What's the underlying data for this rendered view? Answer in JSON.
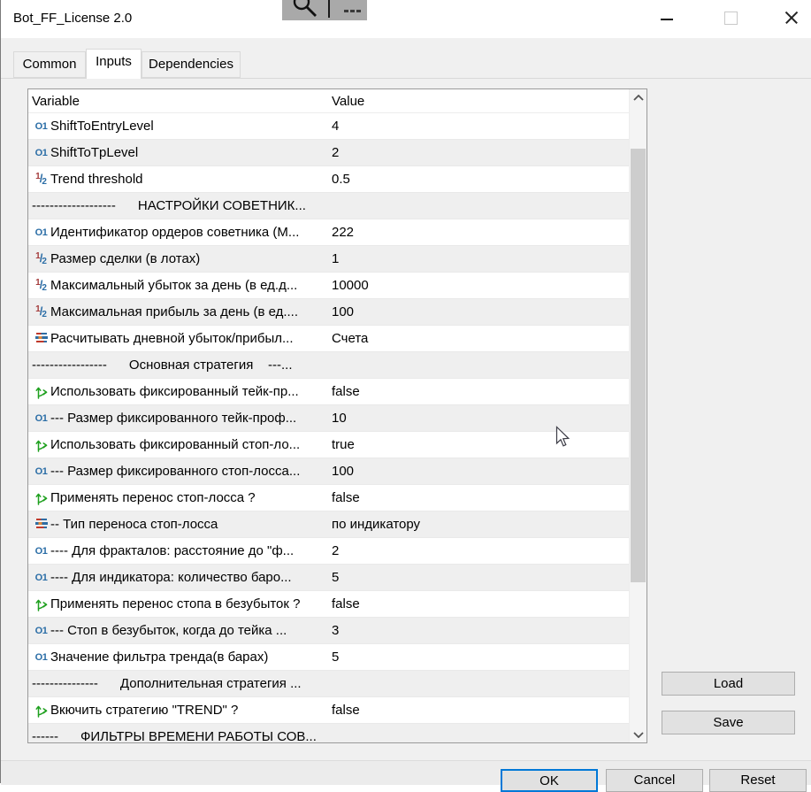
{
  "window": {
    "title": "Bot_FF_License 2.0",
    "controls": {
      "minimize": "minimize",
      "maximize": "maximize",
      "close": "close"
    }
  },
  "capture_toolbar": {
    "icons": [
      "magnifier-icon",
      "caret-divider",
      "ellipsis-icon"
    ]
  },
  "tabs": [
    {
      "label": "Common",
      "active": false
    },
    {
      "label": "Inputs",
      "active": true
    },
    {
      "label": "Dependencies",
      "active": false
    }
  ],
  "table": {
    "columns": [
      "Variable",
      "Value"
    ],
    "rows": [
      {
        "type": "int",
        "label": "ShiftToEntryLevel",
        "value": "4"
      },
      {
        "type": "int",
        "label": "ShiftToTpLevel",
        "value": "2"
      },
      {
        "type": "double",
        "label": "Trend threshold",
        "value": "0.5"
      },
      {
        "type": "sep",
        "label": "-------------------      НАСТРОЙКИ СОВЕТНИК...",
        "value": ""
      },
      {
        "type": "int",
        "label": "Идентификатор ордеров советника (М...",
        "value": "222"
      },
      {
        "type": "double",
        "label": "Размер сделки (в лотах)",
        "value": "1"
      },
      {
        "type": "double",
        "label": "Максимальный убыток за день (в ед.д...",
        "value": "10000"
      },
      {
        "type": "double",
        "label": "Максимальная прибыль за день (в ед....",
        "value": "100"
      },
      {
        "type": "enum",
        "label": "Расчитывать дневной убыток/прибыл...",
        "value": "Счета"
      },
      {
        "type": "sep",
        "label": "-----------------      Основная стратегия    ---...",
        "value": ""
      },
      {
        "type": "bool",
        "label": "Использовать фиксированный тейк-пр...",
        "value": "false"
      },
      {
        "type": "int",
        "label": "--- Размер фиксированного тейк-проф...",
        "value": "10"
      },
      {
        "type": "bool",
        "label": "Использовать фиксированный стоп-ло...",
        "value": "true"
      },
      {
        "type": "int",
        "label": "--- Размер фиксированного стоп-лосса...",
        "value": "100"
      },
      {
        "type": "bool",
        "label": "Применять перенос стоп-лосса ?",
        "value": "false"
      },
      {
        "type": "enum",
        "label": "-- Тип переноса стоп-лосса",
        "value": "по индикатору"
      },
      {
        "type": "int",
        "label": "---- Для фракталов: расстояние до \"ф...",
        "value": "2"
      },
      {
        "type": "int",
        "label": "---- Для индикатора: количество баро...",
        "value": "5"
      },
      {
        "type": "bool",
        "label": "Применять перенос стопа в безубыток ?",
        "value": "false"
      },
      {
        "type": "int",
        "label": "--- Стоп в безубыток, когда до тейка ...",
        "value": "3"
      },
      {
        "type": "int",
        "label": "Значение фильтра тренда(в барах)",
        "value": "5"
      },
      {
        "type": "sep",
        "label": "---------------      Дополнительная стратегия ...",
        "value": ""
      },
      {
        "type": "bool",
        "label": "Вкючить стратегию \"TREND\" ?",
        "value": "false"
      },
      {
        "type": "sep",
        "label": "------      ФИЛЬТРЫ ВРЕМЕНИ РАБОТЫ СОВ...",
        "value": ""
      }
    ]
  },
  "side_buttons": {
    "load": "Load",
    "save": "Save"
  },
  "footer_buttons": {
    "ok": "OK",
    "cancel": "Cancel",
    "reset": "Reset"
  },
  "colors": {
    "accent": "#0078d7",
    "zebra_row": "#efefef",
    "icon_int": "#2a6da6",
    "icon_double_numerator": "#a33b3b",
    "icon_bool": "#1ea01e",
    "icon_enum_red": "#c0392b",
    "icon_enum_blue": "#2e6da4",
    "toolbar_gray": "#a9a9a9"
  }
}
